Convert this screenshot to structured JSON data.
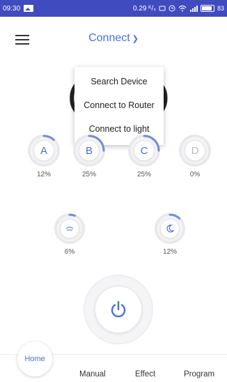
{
  "status_bar": {
    "time": "09:30",
    "speed": "0.29 ᴷ/ₛ",
    "battery": "83"
  },
  "header": {
    "title": "Connect",
    "menu_icon": "hamburger-icon",
    "chevron_icon": "chevron-down-icon"
  },
  "dropdown": {
    "items": [
      "Search Device",
      "Connect to Router",
      "Connect to light"
    ]
  },
  "channels": [
    {
      "label": "A",
      "percent": "12%",
      "level": 0.12
    },
    {
      "label": "B",
      "percent": "25%",
      "level": 0.25
    },
    {
      "label": "C",
      "percent": "25%",
      "level": 0.25
    },
    {
      "label": "D",
      "percent": "0%",
      "level": 0.0
    }
  ],
  "modes": [
    {
      "icon": "cloud-light-icon",
      "percent": "6%",
      "level": 0.06
    },
    {
      "icon": "moon-icon",
      "percent": "12%",
      "level": 0.12
    }
  ],
  "power": {
    "icon": "power-icon"
  },
  "tabs": {
    "home": "Home",
    "manual": "Manual",
    "effect": "Effect",
    "program": "Program"
  },
  "colors": {
    "status_bar": "#3f4bbf",
    "accent": "#4a6fd6"
  }
}
